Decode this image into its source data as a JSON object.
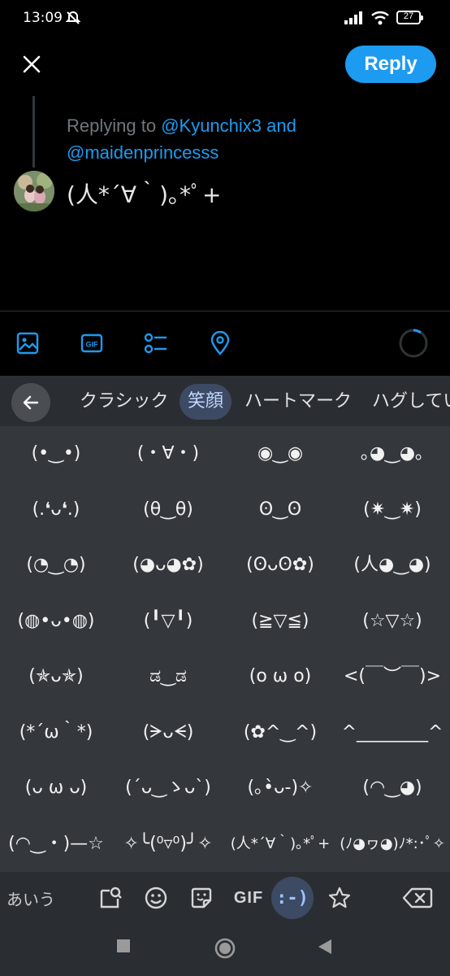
{
  "status": {
    "time": "13:09",
    "battery": "27"
  },
  "header": {
    "reply_label": "Reply"
  },
  "compose": {
    "replying_prefix": "Replying to ",
    "handle1": "@Kyunchix3",
    "and_word": " and",
    "handle2": "@maidenprincesss",
    "text": "(人*´∀｀)｡*ﾟ+"
  },
  "toolbar": {
    "icons": [
      "image-icon",
      "gif-icon",
      "poll-icon",
      "location-icon"
    ]
  },
  "keyboard": {
    "tabs": [
      "クラシック",
      "笑顔",
      "ハートマーク",
      "ハグしてい"
    ],
    "active_tab": "笑顔",
    "emoticons": [
      [
        "(•‿•)",
        "(・∀・)",
        "◉‿◉",
        "｡◕‿◕｡"
      ],
      [
        "(.❛ᴗ❛.)",
        "(θ‿θ)",
        "ʘ‿ʘ",
        "(✷‿✷)"
      ],
      [
        "(◔‿◔)",
        "(◕ᴗ◕✿)",
        "(ʘᴗʘ✿)",
        "(人◕‿◕)"
      ],
      [
        "(◍•ᴗ•◍)",
        "(╹▽╹)",
        "(≧▽≦)",
        "(☆▽☆)"
      ],
      [
        "(✯ᴗ✯)",
        "ಡ‿ಡ",
        "(o ω o)",
        "<(￣︶￣)>"
      ],
      [
        "(*´ω｀*)",
        "(ᗒᴗᗕ)",
        "(✿^‿^)",
        "^________^"
      ],
      [
        "(ᴗ ω ᴗ)",
        "(´ᴗ‿ゝᴗ`)",
        "(｡•̀ᴗ-)✧",
        "(◠‿◕)"
      ],
      [
        "(◠‿・)—☆",
        "✧╰(⁰▿⁰)╯✧",
        "(人*´∀｀)｡*ﾟ+",
        "(ﾉ◕ヮ◕)ﾉ*:･ﾟ✧"
      ]
    ],
    "ime_label": "あいう",
    "gif_label": "GIF",
    "emoticon_label": ":-)"
  }
}
